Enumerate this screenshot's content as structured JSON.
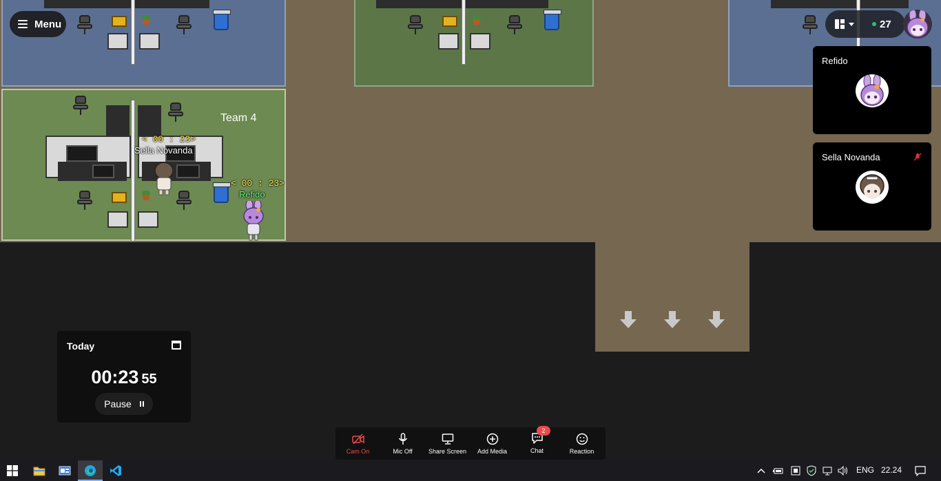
{
  "app": {
    "menu_label": "Menu",
    "online_count": "27",
    "room_label": "Team 4"
  },
  "map": {
    "players": [
      {
        "name": "Sella Novanda",
        "timer": "< 00 : 23>",
        "name_color": "#ffffff"
      },
      {
        "name": "Refido",
        "timer": "< 00 : 23>",
        "name_color": "#6cf07a"
      }
    ]
  },
  "video_tiles": [
    {
      "name": "Refido",
      "avatar": "purple-bunny-avatar",
      "mic_muted": false
    },
    {
      "name": "Sella Novanda",
      "avatar": "brown-hair-avatar",
      "mic_muted": true
    }
  ],
  "timer_widget": {
    "title": "Today",
    "hours": "00",
    "separator": ":",
    "minutes": "23",
    "seconds": "55",
    "pause_label": "Pause"
  },
  "toolbar": {
    "cam_label": "Cam On",
    "mic_label": "Mic Off",
    "share_label": "Share Screen",
    "media_label": "Add Media",
    "chat_label": "Chat",
    "chat_badge": "2",
    "reaction_label": "Reaction"
  },
  "taskbar": {
    "language": "ENG",
    "time": "22.24"
  },
  "colors": {
    "accent_red": "#ea4b4b",
    "online_green": "#1ec66e",
    "timer_yellow": "#ffe24a"
  }
}
